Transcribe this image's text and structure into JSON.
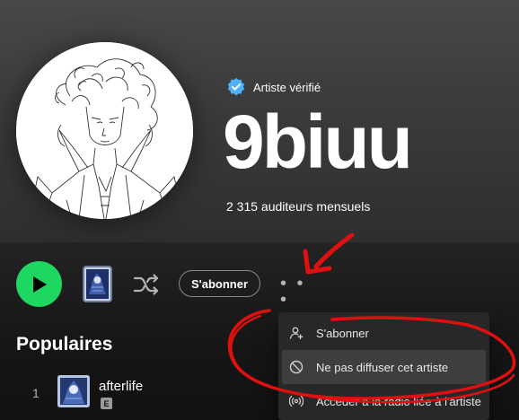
{
  "artist": {
    "verified_label": "Artiste vérifié",
    "name": "9biuu",
    "monthly_listeners": "2 315 auditeurs mensuels"
  },
  "actions": {
    "follow_label": "S'abonner",
    "more_label": "• • •"
  },
  "popular": {
    "title": "Populaires",
    "tracks": [
      {
        "number": "1",
        "title": "afterlife",
        "explicit_badge": "E"
      }
    ]
  },
  "context_menu": {
    "items": [
      {
        "label": "S'abonner",
        "icon": "person-add-icon"
      },
      {
        "label": "Ne pas diffuser cet artiste",
        "icon": "block-icon"
      },
      {
        "label": "Accéder à la radio liée à l'artiste",
        "icon": "radio-icon"
      }
    ]
  },
  "colors": {
    "accent_green": "#1ed760",
    "verified_blue": "#4cb3ff",
    "annotation_red": "#e01010",
    "background": "#121212",
    "menu_bg": "#282828"
  }
}
